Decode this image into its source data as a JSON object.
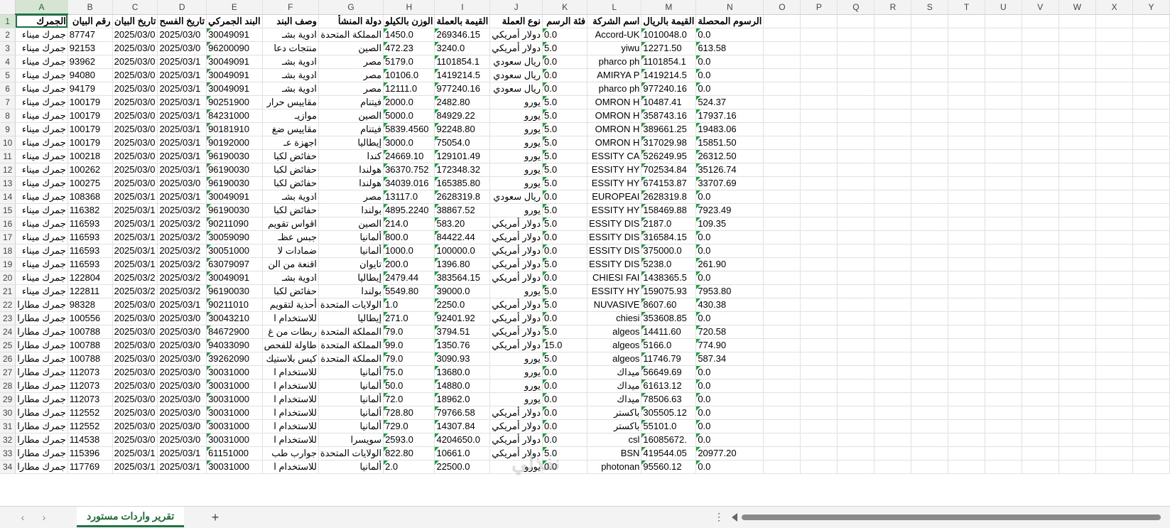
{
  "columns": [
    "A",
    "B",
    "C",
    "D",
    "E",
    "F",
    "G",
    "H",
    "I",
    "J",
    "K",
    "L",
    "M",
    "N",
    "O",
    "P",
    "Q",
    "R",
    "S",
    "T",
    "U",
    "V",
    "W",
    "X",
    "Y"
  ],
  "active_column": "A",
  "active_row": "1",
  "header_row": [
    "الجمرك",
    "رقم البيان",
    "تاريخ البيان",
    "تاريخ الفسح",
    "البند الجمركي",
    "وصف البند",
    "دولة المنشأ",
    "الوزن بالكيلو",
    "القيمة بالعملة",
    "نوع العملة",
    "فئة الرسم",
    "اسم الشركة",
    "القيمة بالريال",
    "الرسوم المحصلة"
  ],
  "rows": [
    {
      "n": "2",
      "c": [
        "جمرك ميناء",
        "87747",
        "2025/03/0",
        "2025/03/0",
        "30049091",
        "ادوية بشـ",
        "المملكة المتحدة",
        "1450.0",
        "269346.15",
        "دولار أمريكي",
        "0.0",
        "Accord-UK",
        "1010048.0",
        "0.0"
      ]
    },
    {
      "n": "3",
      "c": [
        "جمرك ميناء",
        "92153",
        "2025/03/0",
        "2025/03/0",
        "96200090",
        "منتجات دعا",
        "الصين",
        "472.23",
        "3240.0",
        "دولار أمريكي",
        "5.0",
        "yiwu",
        "12271.50",
        "613.58"
      ]
    },
    {
      "n": "4",
      "c": [
        "جمرك ميناء",
        "93962",
        "2025/03/0",
        "2025/03/1",
        "30049091",
        "ادوية بشـ",
        "مصر",
        "5179.0",
        "1101854.1",
        "ريال سعودي",
        "0.0",
        "pharco ph",
        "1101854.1",
        "0.0"
      ]
    },
    {
      "n": "5",
      "c": [
        "جمرك ميناء",
        "94080",
        "2025/03/0",
        "2025/03/1",
        "30049091",
        "ادوية بشـ",
        "مصر",
        "10106.0",
        "1419214.5",
        "ريال سعودي",
        "0.0",
        "AMIRYA P",
        "1419214.5",
        "0.0"
      ]
    },
    {
      "n": "6",
      "c": [
        "جمرك ميناء",
        "94179",
        "2025/03/0",
        "2025/03/1",
        "30049091",
        "ادوية بشـ",
        "مصر",
        "12111.0",
        "977240.16",
        "ريال سعودي",
        "0.0",
        "pharco ph",
        "977240.16",
        "0.0"
      ]
    },
    {
      "n": "7",
      "c": [
        "جمرك ميناء",
        "100179",
        "2025/03/0",
        "2025/03/1",
        "90251900",
        "مقاييس حرار",
        "فيتنام",
        "2000.0",
        "2482.80",
        "يورو",
        "5.0",
        "OMRON H",
        "10487.41",
        "524.37"
      ]
    },
    {
      "n": "8",
      "c": [
        "جمرك ميناء",
        "100179",
        "2025/03/0",
        "2025/03/1",
        "84231000",
        "موازيـ",
        "الصين",
        "5000.0",
        "84929.22",
        "يورو",
        "5.0",
        "OMRON H",
        "358743.16",
        "17937.16"
      ]
    },
    {
      "n": "9",
      "c": [
        "جمرك ميناء",
        "100179",
        "2025/03/0",
        "2025/03/1",
        "90181910",
        "مقاييس ضغ",
        "فيتنام",
        "5839.4560",
        "92248.80",
        "يورو",
        "5.0",
        "OMRON H",
        "389661.25",
        "19483.06"
      ]
    },
    {
      "n": "10",
      "c": [
        "جمرك ميناء",
        "100179",
        "2025/03/0",
        "2025/03/1",
        "90192000",
        "اجهزة عـ",
        "إيطاليا",
        "3000.0",
        "75054.0",
        "يورو",
        "5.0",
        "OMRON H",
        "317029.98",
        "15851.50"
      ]
    },
    {
      "n": "11",
      "c": [
        "جمرك ميناء",
        "100218",
        "2025/03/0",
        "2025/03/1",
        "96190030",
        "حفائض لكبا",
        "كندا",
        "24669.10",
        "129101.49",
        "يورو",
        "5.0",
        "ESSITY CA",
        "526249.95",
        "26312.50"
      ]
    },
    {
      "n": "12",
      "c": [
        "جمرك ميناء",
        "100262",
        "2025/03/0",
        "2025/03/1",
        "96190030",
        "حفائض لكبا",
        "هولندا",
        "36370.752",
        "172348.32",
        "يورو",
        "5.0",
        "ESSITY HY",
        "702534.84",
        "35126.74"
      ]
    },
    {
      "n": "13",
      "c": [
        "جمرك ميناء",
        "100275",
        "2025/03/0",
        "2025/03/0",
        "96190030",
        "حفائض لكبا",
        "هولندا",
        "34039.016",
        "165385.80",
        "يورو",
        "5.0",
        "ESSITY HY",
        "674153.87",
        "33707.69"
      ]
    },
    {
      "n": "14",
      "c": [
        "جمرك ميناء",
        "108368",
        "2025/03/1",
        "2025/03/1",
        "30049091",
        "ادوية بشـ",
        "مصر",
        "13117.0",
        "2628319.8",
        "ريال سعودي",
        "0.0",
        "EUROPEAI",
        "2628319.8",
        "0.0"
      ]
    },
    {
      "n": "15",
      "c": [
        "جمرك ميناء",
        "116382",
        "2025/03/1",
        "2025/03/2",
        "96190030",
        "حفائض لكبا",
        "بولندا",
        "4895.2240",
        "38867.52",
        "يورو",
        "5.0",
        "ESSITY HY",
        "158469.88",
        "7923.49"
      ]
    },
    {
      "n": "16",
      "c": [
        "جمرك ميناء",
        "116593",
        "2025/03/1",
        "2025/03/2",
        "90211090",
        "اقواس تقويم",
        "الصين",
        "214.0",
        "583.20",
        "دولار أمريكي",
        "5.0",
        "ESSITY DIS",
        "2187.0",
        "109.35"
      ]
    },
    {
      "n": "17",
      "c": [
        "جمرك ميناء",
        "116593",
        "2025/03/1",
        "2025/03/2",
        "30059090",
        "جبس عظـ",
        "ألمانيا",
        "800.0",
        "84422.44",
        "دولار أمريكي",
        "0.0",
        "ESSITY DIS",
        "316584.15",
        "0.0"
      ]
    },
    {
      "n": "18",
      "c": [
        "جمرك ميناء",
        "116593",
        "2025/03/1",
        "2025/03/2",
        "30051000",
        "ضمادات لا",
        "ألمانيا",
        "1000.0",
        "100000.0",
        "دولار أمريكي",
        "0.0",
        "ESSITY DIS",
        "375000.0",
        "0.0"
      ]
    },
    {
      "n": "19",
      "c": [
        "جمرك ميناء",
        "116593",
        "2025/03/1",
        "2025/03/2",
        "63079097",
        "اقنعة من الن",
        "تايوان",
        "200.0",
        "1396.80",
        "دولار أمريكي",
        "5.0",
        "ESSITY DIS",
        "5238.0",
        "261.90"
      ]
    },
    {
      "n": "20",
      "c": [
        "جمرك ميناء",
        "122804",
        "2025/03/2",
        "2025/03/2",
        "30049091",
        "ادوية بشـ",
        "إيطاليا",
        "2479.44",
        "383564.15",
        "دولار أمريكي",
        "0.0",
        "CHIESI FAI",
        "1438365.5",
        "0.0"
      ]
    },
    {
      "n": "21",
      "c": [
        "جمرك ميناء",
        "122811",
        "2025/03/2",
        "2025/03/2",
        "96190030",
        "حفائض لكبا",
        "بولندا",
        "5549.80",
        "39000.0",
        "يورو",
        "5.0",
        "ESSITY HY",
        "159075.93",
        "7953.80"
      ]
    },
    {
      "n": "22",
      "c": [
        "جمرك مطارا",
        "98328",
        "2025/03/0",
        "2025/03/1",
        "90211010",
        "أحذية لتقويم",
        "الولايات المتحدة",
        "1.0",
        "2250.0",
        "دولار أمريكي",
        "5.0",
        "NUVASIVE",
        "8607.60",
        "430.38"
      ]
    },
    {
      "n": "23",
      "c": [
        "جمرك مطارا",
        "100556",
        "2025/03/0",
        "2025/03/0",
        "30043210",
        "للاستخدام ا",
        "إيطاليا",
        "271.0",
        "92401.92",
        "دولار أمريكي",
        "0.0",
        "chiesi",
        "353608.85",
        "0.0"
      ]
    },
    {
      "n": "24",
      "c": [
        "جمرك مطارا",
        "100788",
        "2025/03/0",
        "2025/03/0",
        "84672900",
        "ربطات من غ",
        "المملكة المتحدة",
        "79.0",
        "3794.51",
        "دولار أمريكي",
        "5.0",
        "algeos",
        "14411.60",
        "720.58"
      ]
    },
    {
      "n": "25",
      "c": [
        "جمرك مطارا",
        "100788",
        "2025/03/0",
        "2025/03/0",
        "94033090",
        "طاولة للفحص",
        "المملكة المتحدة",
        "99.0",
        "1350.76",
        "دولار أمريكي",
        "15.0",
        "algeos",
        "5166.0",
        "774.90"
      ]
    },
    {
      "n": "26",
      "c": [
        "جمرك مطارا",
        "100788",
        "2025/03/0",
        "2025/03/0",
        "39262090",
        "كيس بلاستيك",
        "المملكة المتحدة",
        "79.0",
        "3090.93",
        "يورو",
        "5.0",
        "algeos",
        "11746.79",
        "587.34"
      ]
    },
    {
      "n": "27",
      "c": [
        "جمرك مطارا",
        "112073",
        "2025/03/0",
        "2025/03/0",
        "30031000",
        "للاستخدام ا",
        "ألمانيا",
        "75.0",
        "13680.0",
        "يورو",
        "0.0",
        "ميداك",
        "56649.69",
        "0.0"
      ]
    },
    {
      "n": "28",
      "c": [
        "جمرك مطارا",
        "112073",
        "2025/03/0",
        "2025/03/0",
        "30031000",
        "للاستخدام ا",
        "ألمانيا",
        "50.0",
        "14880.0",
        "يورو",
        "0.0",
        "ميداك",
        "61613.12",
        "0.0"
      ]
    },
    {
      "n": "29",
      "c": [
        "جمرك مطارا",
        "112073",
        "2025/03/0",
        "2025/03/0",
        "30031000",
        "للاستخدام ا",
        "ألمانيا",
        "72.0",
        "18962.0",
        "يورو",
        "0.0",
        "ميداك",
        "78506.63",
        "0.0"
      ]
    },
    {
      "n": "30",
      "c": [
        "جمرك مطارا",
        "112552",
        "2025/03/0",
        "2025/03/0",
        "30031000",
        "للاستخدام ا",
        "ألمانيا",
        "728.80",
        "79766.58",
        "دولار أمريكي",
        "0.0",
        "باكستر",
        "305505.12",
        "0.0"
      ]
    },
    {
      "n": "31",
      "c": [
        "جمرك مطارا",
        "112552",
        "2025/03/0",
        "2025/03/0",
        "30031000",
        "للاستخدام ا",
        "ألمانيا",
        "729.0",
        "14307.84",
        "دولار أمريكي",
        "0.0",
        "باكستر",
        "55101.0",
        "0.0"
      ]
    },
    {
      "n": "32",
      "c": [
        "جمرك مطارا",
        "114538",
        "2025/03/0",
        "2025/03/0",
        "30031000",
        "للاستخدام ا",
        "سويسرا",
        "2593.0",
        "4204650.0",
        "دولار أمريكي",
        "0.0",
        "csl",
        "16085672.",
        "0.0"
      ]
    },
    {
      "n": "33",
      "c": [
        "جمرك مطارا",
        "115396",
        "2025/03/1",
        "2025/03/1",
        "61151000",
        "جوارب طب",
        "الولايات المتحدة",
        "822.80",
        "10661.0",
        "دولار أمريكي",
        "5.0",
        "BSN",
        "419544.05",
        "20977.20"
      ]
    },
    {
      "n": "34",
      "c": [
        "جمرك مطارا",
        "117769",
        "2025/03/1",
        "2025/03/1",
        "30031000",
        "للاستخدام ا",
        "ألمانيا",
        "2.0",
        "22500.0",
        "يورو",
        "0.0",
        "photonan",
        "95560.12",
        "0.0"
      ]
    }
  ],
  "sheet_tab": "تقرير واردات مستورد",
  "watermark_text": "نفذلي",
  "watermark_url": "nafezly.com",
  "icons": {
    "prev": "chevron-left",
    "next": "chevron-right",
    "add": "plus",
    "more": "vertical-dots"
  }
}
